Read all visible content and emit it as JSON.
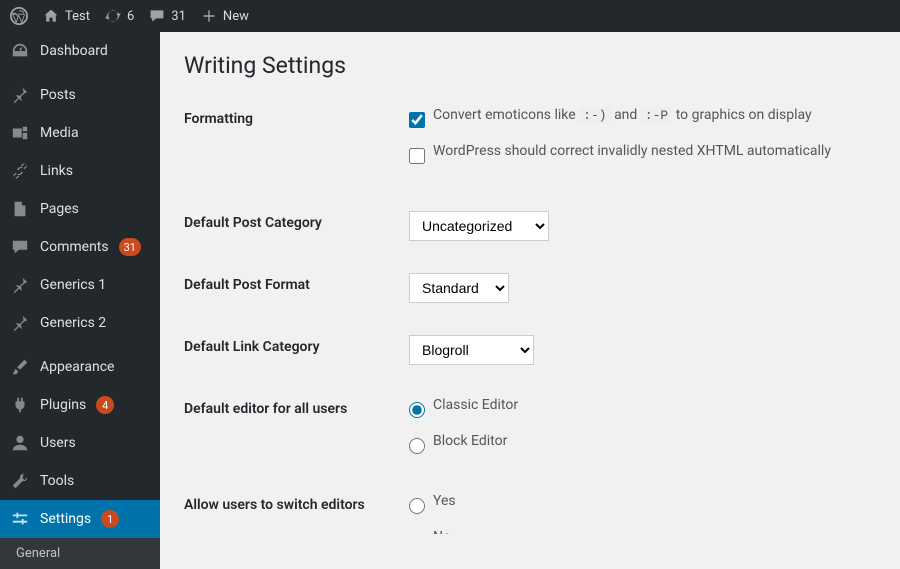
{
  "adminbar": {
    "site_name": "Test",
    "updates": "6",
    "comments": "31",
    "new": "New"
  },
  "sidebar": {
    "dashboard": "Dashboard",
    "posts": "Posts",
    "media": "Media",
    "links": "Links",
    "pages": "Pages",
    "comments": "Comments",
    "comments_badge": "31",
    "generics1": "Generics 1",
    "generics2": "Generics 2",
    "appearance": "Appearance",
    "plugins": "Plugins",
    "plugins_badge": "4",
    "users": "Users",
    "tools": "Tools",
    "settings": "Settings",
    "settings_badge": "1",
    "submenu_general": "General"
  },
  "page": {
    "title": "Writing Settings",
    "formatting_label": "Formatting",
    "emoticons_pre": "Convert emoticons like",
    "emoticons_code1": ":-)",
    "emoticons_mid": "and",
    "emoticons_code2": ":-P",
    "emoticons_post": "to graphics on display",
    "xhtml_label": "WordPress should correct invalidly nested XHTML automatically",
    "default_category_label": "Default Post Category",
    "default_category_value": "Uncategorized",
    "default_format_label": "Default Post Format",
    "default_format_value": "Standard",
    "default_link_category_label": "Default Link Category",
    "default_link_category_value": "Blogroll",
    "default_editor_label": "Default editor for all users",
    "editor_classic": "Classic Editor",
    "editor_block": "Block Editor",
    "allow_switch_label": "Allow users to switch editors",
    "yes": "Yes",
    "no": "No"
  }
}
